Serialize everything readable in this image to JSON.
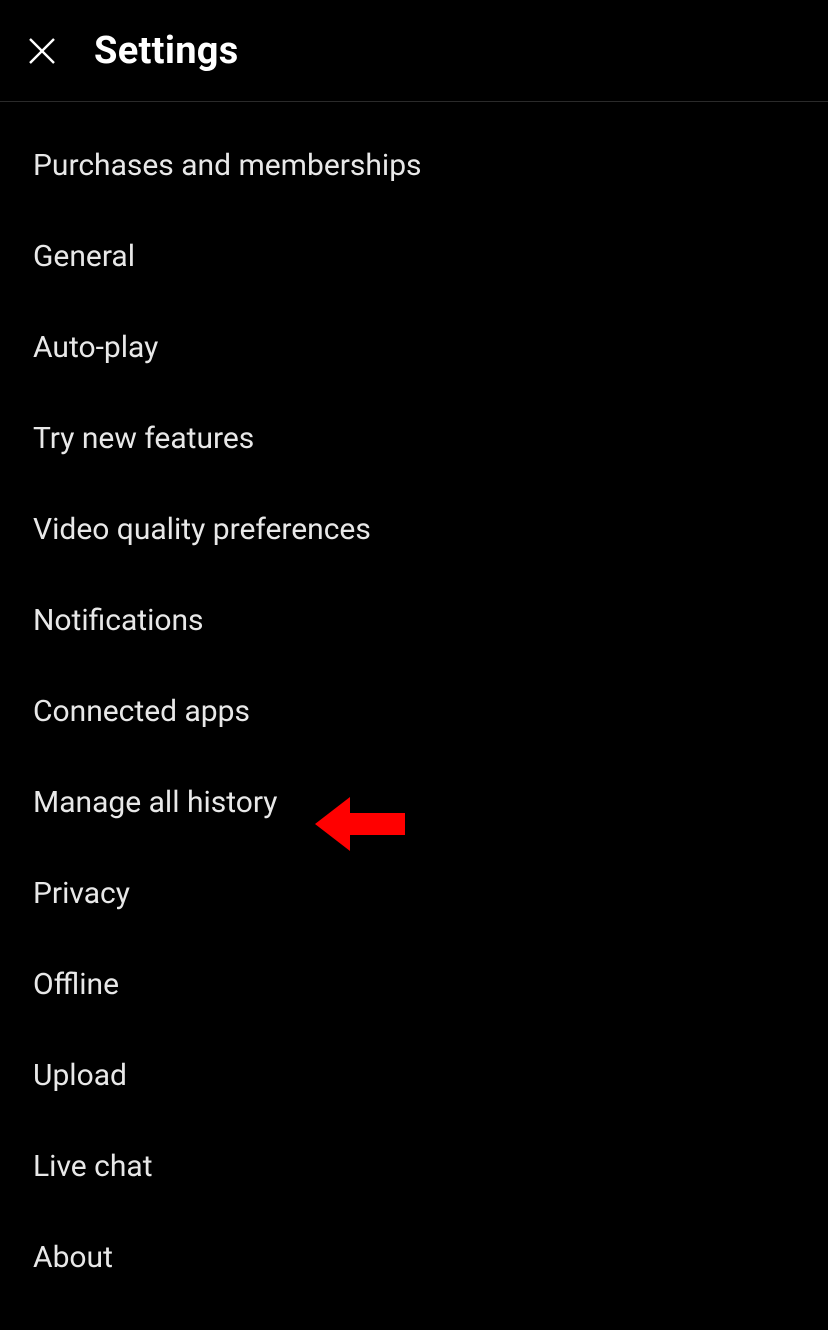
{
  "header": {
    "title": "Settings"
  },
  "menu": {
    "items": [
      {
        "label": "Purchases and memberships",
        "key": "purchases"
      },
      {
        "label": "General",
        "key": "general"
      },
      {
        "label": "Auto-play",
        "key": "autoplay"
      },
      {
        "label": "Try new features",
        "key": "try-new-features"
      },
      {
        "label": "Video quality preferences",
        "key": "video-quality"
      },
      {
        "label": "Notifications",
        "key": "notifications"
      },
      {
        "label": "Connected apps",
        "key": "connected-apps"
      },
      {
        "label": "Manage all history",
        "key": "manage-history"
      },
      {
        "label": "Privacy",
        "key": "privacy"
      },
      {
        "label": "Offline",
        "key": "offline"
      },
      {
        "label": "Upload",
        "key": "upload"
      },
      {
        "label": "Live chat",
        "key": "live-chat"
      },
      {
        "label": "About",
        "key": "about"
      }
    ]
  },
  "annotation": {
    "color": "#ff0000",
    "target_item_index": 7
  }
}
